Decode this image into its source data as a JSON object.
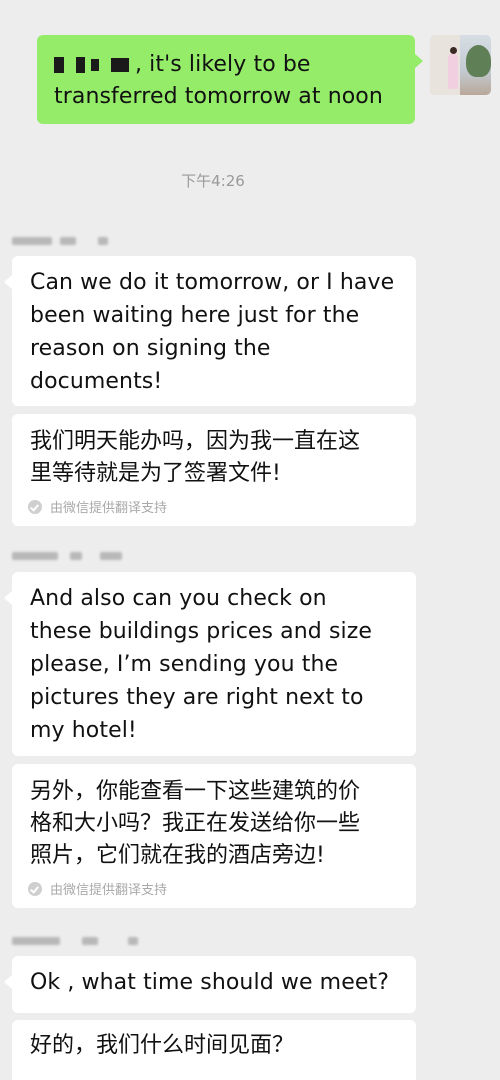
{
  "outgoing": {
    "line1_text": ", it's likely to be",
    "line2_text": "transferred tomorrow at noon"
  },
  "timestamp": "下午4:26",
  "messages": [
    {
      "lines": [
        "Can we do it tomorrow, or I have",
        "been waiting here just for the",
        "reason on signing the",
        "documents!"
      ],
      "translation": [
        "我们明天能办吗，因为我一直在这",
        "里等待就是为了签署文件!"
      ],
      "translation_credit": "由微信提供翻译支持"
    },
    {
      "lines": [
        "And also can you check on",
        "these buildings prices and size",
        "please, I’m sending you the",
        "pictures they are right next to",
        "my hotel!"
      ],
      "translation": [
        "另外，你能查看一下这些建筑的价",
        "格和大小吗？我正在发送给你一些",
        "照片，它们就在我的酒店旁边!"
      ],
      "translation_credit": "由微信提供翻译支持"
    },
    {
      "lines": [
        "Ok , what time should we meet?"
      ],
      "translation": [
        "好的，我们什么时间见面？"
      ]
    }
  ],
  "colors": {
    "background": "#ededed",
    "outgoing_bubble": "#95ec69",
    "incoming_bubble": "#ffffff"
  }
}
